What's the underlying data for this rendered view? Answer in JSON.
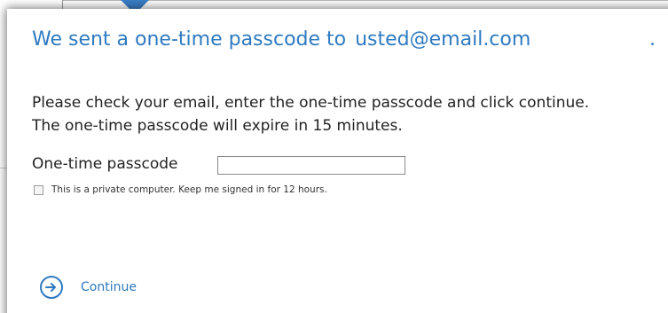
{
  "dialog": {
    "heading_prefix": "We sent a one-time passcode to",
    "email": "usted@email.com",
    "heading_suffix": ".",
    "instruction_line1": "Please check your email, enter the one-time passcode and click continue.",
    "instruction_line2": "The one-time passcode will expire in 15 minutes.",
    "passcode_label": "One-time passcode",
    "passcode_value": "",
    "remember_label": "This is a private computer. Keep me signed in for 12 hours.",
    "remember_checked": false,
    "continue_label": "Continue"
  },
  "icons": {
    "continue": "arrow-right-circle-icon",
    "pointer": "callout-pointer-icon"
  },
  "colors": {
    "accent": "#2f7ac0",
    "pointer": "#3a7fc6",
    "text": "#222222"
  }
}
